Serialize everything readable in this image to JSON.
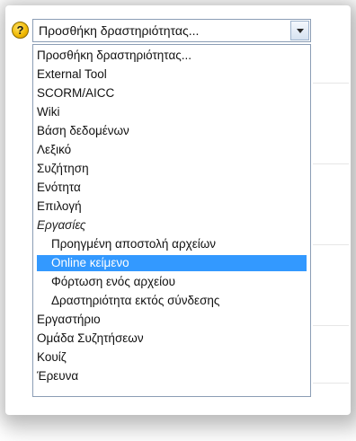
{
  "select": {
    "help_icon_glyph": "?",
    "current_value": "Προσθήκη δραστηριότητας..."
  },
  "options": [
    {
      "label": "Προσθήκη δραστηριότητας...",
      "kind": "option"
    },
    {
      "label": "External Tool",
      "kind": "option"
    },
    {
      "label": "SCORM/AICC",
      "kind": "option"
    },
    {
      "label": "Wiki",
      "kind": "option"
    },
    {
      "label": "Βάση δεδομένων",
      "kind": "option"
    },
    {
      "label": "Λεξικό",
      "kind": "option"
    },
    {
      "label": "Συζήτηση",
      "kind": "option"
    },
    {
      "label": "Ενότητα",
      "kind": "option"
    },
    {
      "label": "Επιλογή",
      "kind": "option"
    },
    {
      "label": "Εργασίες",
      "kind": "group"
    },
    {
      "label": "Προηγμένη αποστολή αρχείων",
      "kind": "child"
    },
    {
      "label": "Online κείμενο",
      "kind": "child",
      "selected": true
    },
    {
      "label": "Φόρτωση ενός αρχείου",
      "kind": "child"
    },
    {
      "label": "Δραστηριότητα εκτός σύνδεσης",
      "kind": "child"
    },
    {
      "label": "Εργαστήριο",
      "kind": "option"
    },
    {
      "label": "Ομάδα Συζητήσεων",
      "kind": "option"
    },
    {
      "label": "Κουίζ",
      "kind": "option"
    },
    {
      "label": "Έρευνα",
      "kind": "option"
    }
  ],
  "colors": {
    "highlight": "#3399ff",
    "border": "#8b9db5",
    "help_icon": "#f0b800"
  }
}
